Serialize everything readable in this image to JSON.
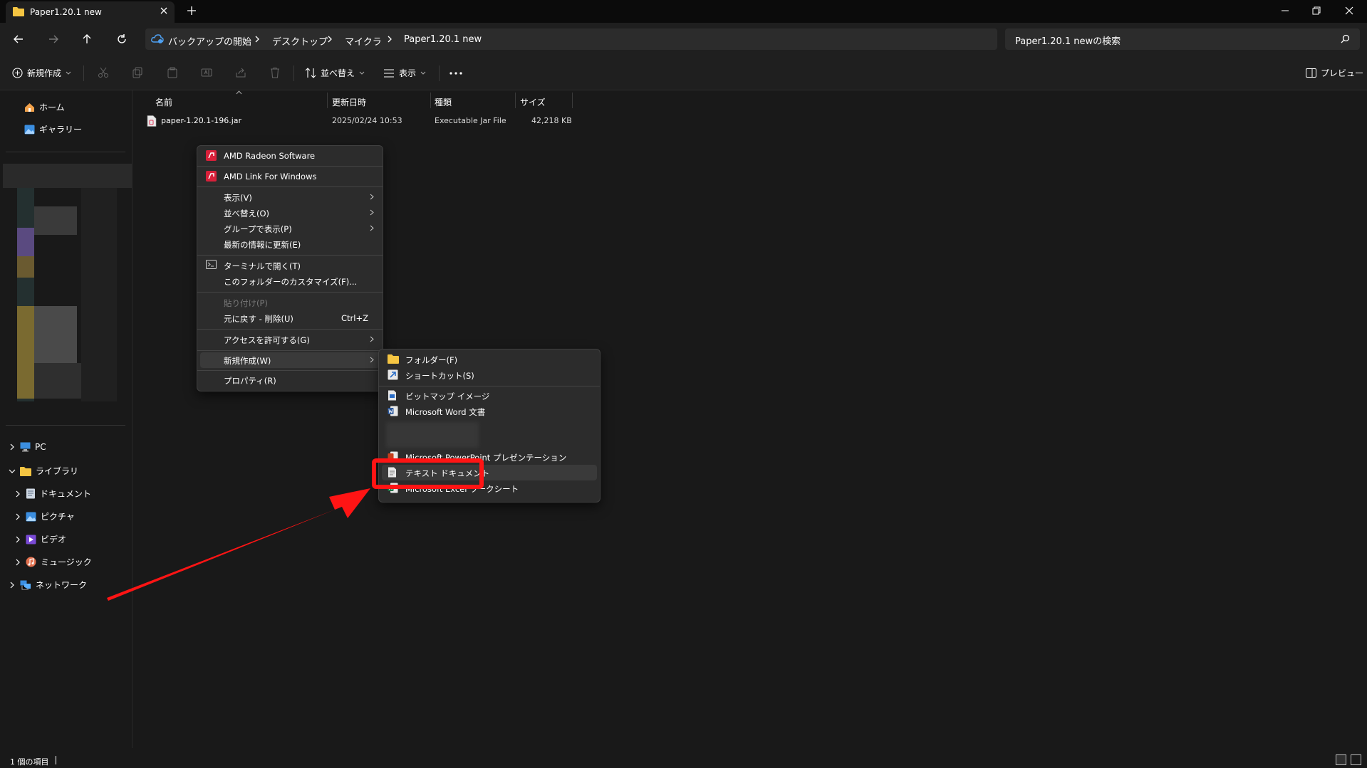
{
  "window": {
    "tab_title": "Paper1.20.1 new"
  },
  "address": {
    "crumbs": [
      "バックアップの開始",
      "デスクトップ",
      "マイクラ",
      "Paper1.20.1 new"
    ],
    "search_placeholder": "Paper1.20.1 newの検索"
  },
  "toolbar": {
    "new_label": "新規作成",
    "sort_label": "並べ替え",
    "view_label": "表示",
    "preview_label": "プレビュー"
  },
  "sidebar": {
    "home": "ホーム",
    "gallery": "ギャラリー",
    "pc": "PC",
    "library": "ライブラリ",
    "documents": "ドキュメント",
    "pictures": "ピクチャ",
    "videos": "ビデオ",
    "music": "ミュージック",
    "network": "ネットワーク"
  },
  "columns": {
    "name": "名前",
    "modified": "更新日時",
    "type": "種類",
    "size": "サイズ"
  },
  "files": [
    {
      "name": "paper-1.20.1-196.jar",
      "modified": "2025/02/24 10:53",
      "type": "Executable Jar File",
      "size": "42,218 KB"
    }
  ],
  "context_menu": {
    "items": [
      {
        "label": "AMD Radeon Software",
        "icon": "amd-icon"
      },
      {
        "label": "AMD Link For Windows",
        "icon": "amd-icon"
      },
      {
        "label": "表示(V)",
        "submenu": true
      },
      {
        "label": "並べ替え(O)",
        "submenu": true
      },
      {
        "label": "グループで表示(P)",
        "submenu": true
      },
      {
        "label": "最新の情報に更新(E)"
      },
      {
        "label": "ターミナルで開く(T)",
        "icon": "terminal-icon"
      },
      {
        "label": "このフォルダーのカスタマイズ(F)..."
      },
      {
        "label": "貼り付け(P)",
        "disabled": true
      },
      {
        "label": "元に戻す - 削除(U)",
        "shortcut": "Ctrl+Z"
      },
      {
        "label": "アクセスを許可する(G)",
        "submenu": true
      },
      {
        "label": "新規作成(W)",
        "submenu": true,
        "highlighted": true
      },
      {
        "label": "プロパティ(R)"
      }
    ]
  },
  "new_submenu": {
    "items": [
      {
        "label": "フォルダー(F)",
        "icon": "folder-icon"
      },
      {
        "label": "ショートカット(S)",
        "icon": "shortcut-icon"
      },
      {
        "label": "ビットマップ イメージ",
        "icon": "bitmap-icon"
      },
      {
        "label": "Microsoft Word 文書",
        "icon": "word-icon"
      },
      {
        "label": "Microsoft PowerPoint プレゼンテーション",
        "icon": "powerpoint-icon"
      },
      {
        "label": "テキスト ドキュメント",
        "icon": "text-document-icon",
        "highlighted": true
      },
      {
        "label": "Microsoft Excel ワークシート",
        "icon": "excel-icon"
      }
    ]
  },
  "status": {
    "item_count": "1 個の項目"
  },
  "colors": {
    "annotation_red": "#ff1414",
    "background": "#191919",
    "menu_bg": "#2c2c2c"
  }
}
